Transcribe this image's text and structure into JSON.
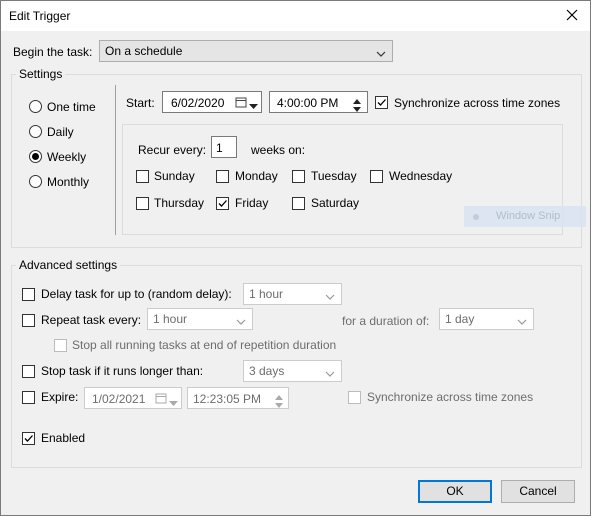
{
  "window": {
    "title": "Edit Trigger"
  },
  "begin": {
    "label": "Begin the task:",
    "value": "On a schedule"
  },
  "settings": {
    "legend": "Settings",
    "radios": [
      {
        "label": "One time",
        "checked": false
      },
      {
        "label": "Daily",
        "checked": false
      },
      {
        "label": "Weekly",
        "checked": true
      },
      {
        "label": "Monthly",
        "checked": false
      }
    ],
    "start_label": "Start:",
    "start_date": "6/02/2020",
    "start_time": "4:00:00 PM",
    "sync_label": "Synchronize across time zones",
    "recur_label": "Recur every:",
    "recur_value": "1",
    "weeks_on_label": "weeks on:",
    "days": [
      {
        "label": "Sunday",
        "checked": false
      },
      {
        "label": "Monday",
        "checked": false
      },
      {
        "label": "Tuesday",
        "checked": false
      },
      {
        "label": "Wednesday",
        "checked": false
      },
      {
        "label": "Thursday",
        "checked": false
      },
      {
        "label": "Friday",
        "checked": true
      },
      {
        "label": "Saturday",
        "checked": false
      }
    ],
    "window_snip": "Window Snip"
  },
  "advanced": {
    "legend": "Advanced settings",
    "delay_label": "Delay task for up to (random delay):",
    "delay_value": "1 hour",
    "repeat_label": "Repeat task every:",
    "repeat_value": "1 hour",
    "duration_label": "for a duration of:",
    "duration_value": "1 day",
    "stop_all_label": "Stop all running tasks at end of repetition duration",
    "stop_longer_label": "Stop task if it runs longer than:",
    "stop_longer_value": "3 days",
    "expire_label": "Expire:",
    "expire_date": "1/02/2021",
    "expire_time": "12:23:05 PM",
    "expire_sync_label": "Synchronize across time zones",
    "enabled_label": "Enabled"
  },
  "buttons": {
    "ok": "OK",
    "cancel": "Cancel"
  }
}
